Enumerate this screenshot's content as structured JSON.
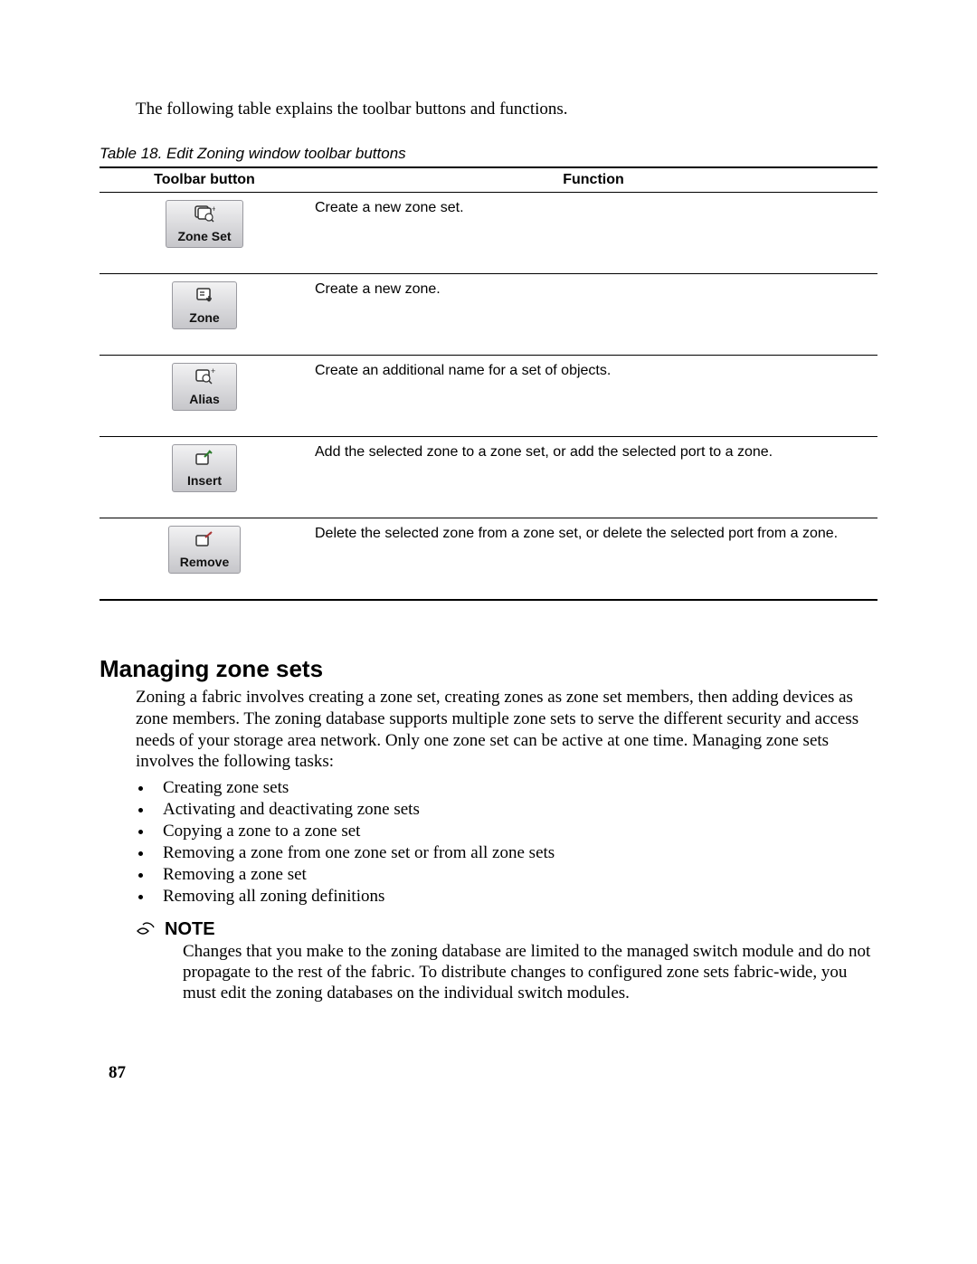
{
  "intro": "The following table explains the toolbar buttons and functions.",
  "table": {
    "caption": "Table 18. Edit Zoning window toolbar buttons",
    "headers": {
      "col1": "Toolbar button",
      "col2": "Function"
    },
    "rows": [
      {
        "button_label": "Zone Set",
        "icon": "zoneset",
        "function": "Create a new zone set."
      },
      {
        "button_label": "Zone",
        "icon": "zone",
        "function": "Create a new zone."
      },
      {
        "button_label": "Alias",
        "icon": "alias",
        "function": "Create an additional name for a set of objects."
      },
      {
        "button_label": "Insert",
        "icon": "insert",
        "function": "Add the selected zone to a zone set, or add the selected port to a zone."
      },
      {
        "button_label": "Remove",
        "icon": "remove",
        "function": "Delete the selected zone from a zone set, or delete the selected port from a zone."
      }
    ]
  },
  "section": {
    "title": "Managing zone sets",
    "body": "Zoning a fabric involves creating a zone set, creating zones as zone set members, then adding devices as zone members. The zoning database supports multiple zone sets to serve the different security and access needs of your storage area network. Only one zone set can be active at one time. Managing zone sets involves the following tasks:",
    "tasks": [
      "Creating zone sets",
      "Activating and deactivating zone sets",
      "Copying a zone to a zone set",
      "Removing a zone from one zone set or from all zone sets",
      "Removing a zone set",
      "Removing all zoning definitions"
    ]
  },
  "note": {
    "label": "NOTE",
    "body": "Changes that you make to the zoning database are limited to the managed switch module and do not propagate to the rest of the fabric. To distribute changes to configured zone sets fabric-wide, you must edit the zoning databases on the individual switch modules."
  },
  "page_number": "87"
}
